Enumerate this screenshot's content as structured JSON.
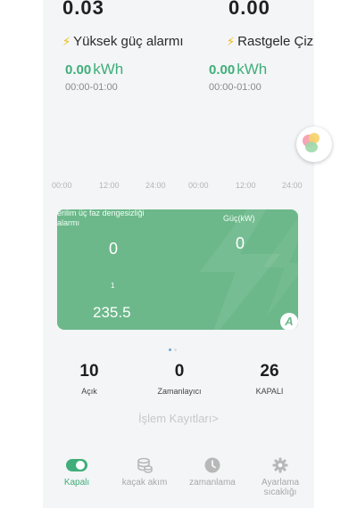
{
  "top_values": {
    "left": "0.03",
    "right": "0.00"
  },
  "alarms": {
    "left": {
      "icon": "lightning-icon",
      "label": "Yüksek güç alarmı",
      "kwh_value": "0.00",
      "kwh_unit": "kWh",
      "range": "00:00-01:00"
    },
    "right": {
      "icon": "lightning-icon",
      "label": "Rastgele Çiz",
      "kwh_value": "0.00",
      "kwh_unit": "kWh",
      "range": "00:00-01:00"
    }
  },
  "timeline_ticks": [
    "00:00",
    "12:00",
    "24:00",
    "00:00",
    "12:00",
    "24:00"
  ],
  "card": {
    "title_left": "erilim üç faz dengesizliği alarmı",
    "title_right": "Güç(kW)",
    "value_left": "0",
    "value_right": "0",
    "small_value": "1",
    "voltage": "235.5",
    "badge": "A"
  },
  "pager": {
    "count": 2,
    "active": 0
  },
  "stats": [
    {
      "value": "10",
      "label": "Açık"
    },
    {
      "value": "0",
      "label": "Zamanlayıcı"
    },
    {
      "value": "26",
      "label": "KAPALI"
    }
  ],
  "log_link": "İşlem Kayıtları>",
  "nav": [
    {
      "label": "Kapalı",
      "icon": "toggle-icon",
      "active": true
    },
    {
      "label": "kaçak akım",
      "icon": "coins-icon",
      "active": false
    },
    {
      "label": "zamanlama",
      "icon": "clock-icon",
      "active": false
    },
    {
      "label": "Ayarlama sıcaklığı",
      "icon": "gear-icon",
      "active": false
    }
  ],
  "colors": {
    "accent": "#3fae7a",
    "card": "#6cb88a",
    "bolt": "#f2b705"
  }
}
